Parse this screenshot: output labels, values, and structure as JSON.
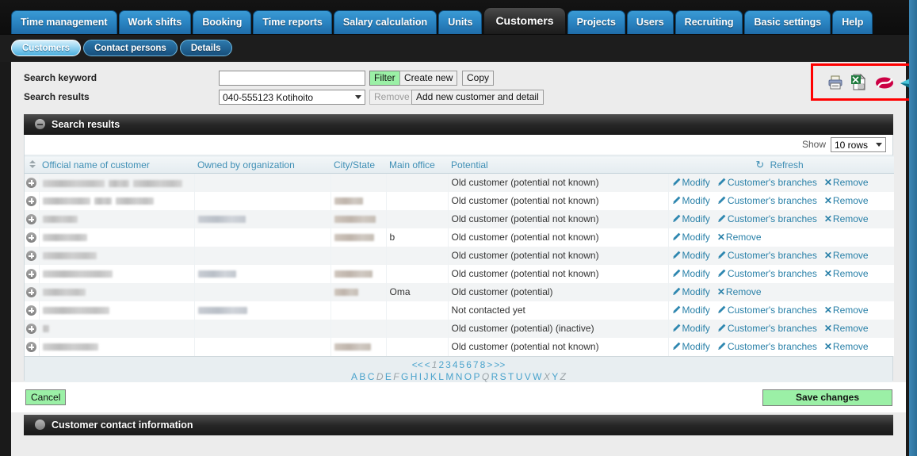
{
  "app": {
    "main_tabs": [
      {
        "label": "Time management",
        "active": false
      },
      {
        "label": "Work shifts",
        "active": false
      },
      {
        "label": "Booking",
        "active": false
      },
      {
        "label": "Time reports",
        "active": false
      },
      {
        "label": "Salary calculation",
        "active": false
      },
      {
        "label": "Units",
        "active": false
      },
      {
        "label": "Customers",
        "active": true
      },
      {
        "label": "Projects",
        "active": false
      },
      {
        "label": "Users",
        "active": false
      },
      {
        "label": "Recruiting",
        "active": false
      },
      {
        "label": "Basic settings",
        "active": false
      },
      {
        "label": "Help",
        "active": false
      }
    ],
    "sub_tabs": [
      {
        "label": "Customers",
        "selected": true
      },
      {
        "label": "Contact persons",
        "selected": false
      },
      {
        "label": "Details",
        "selected": false
      }
    ]
  },
  "search": {
    "keyword_label": "Search keyword",
    "keyword_value": "",
    "keyword_placeholder": "",
    "filter_button": "Filter",
    "create_new_button": "Create new",
    "copy_button": "Copy",
    "results_label": "Search results",
    "results_selected": "040-555123 Kotihoito",
    "remove_button": "Remove",
    "add_new_button": "Add new customer and detail"
  },
  "toolbar_icons": [
    {
      "name": "print-icon",
      "title": "Print"
    },
    {
      "name": "excel-export-icon",
      "title": "Export to Excel"
    },
    {
      "name": "red-oval-icon",
      "title": "PDF"
    },
    {
      "name": "teal-arrow-icon",
      "title": "Send"
    }
  ],
  "sections": {
    "search_results_title": "Search results",
    "contact_info_title": "Customer contact information"
  },
  "table": {
    "show_label": "Show",
    "show_value": "10 rows",
    "refresh_label": "Refresh",
    "columns": [
      "Official name of customer",
      "Owned by organization",
      "City/State",
      "Main office",
      "Potential"
    ],
    "actions": {
      "modify": "Modify",
      "branches": "Customer's branches",
      "remove": "Remove"
    },
    "rows": [
      {
        "name_w": [
          78,
          26,
          62
        ],
        "org_w": [],
        "city_w": [],
        "office": "",
        "potential": "Old customer (potential not known)",
        "has_branches": true
      },
      {
        "name_w": [
          60,
          22,
          48
        ],
        "org_w": [],
        "city_w": [
          36
        ],
        "office": "",
        "potential": "Old customer (potential not known)",
        "has_branches": true
      },
      {
        "name_w": [
          44
        ],
        "org_w": [
          60
        ],
        "city_w": [
          52
        ],
        "office": "",
        "potential": "Old customer (potential not known)",
        "has_branches": true
      },
      {
        "name_w": [
          56
        ],
        "org_w": [],
        "city_w": [
          50
        ],
        "office": "b",
        "potential": "Old customer (potential not known)",
        "has_branches": false
      },
      {
        "name_w": [
          68
        ],
        "org_w": [],
        "city_w": [],
        "office": "",
        "potential": "Old customer (potential not known)",
        "has_branches": true
      },
      {
        "name_w": [
          88
        ],
        "org_w": [
          48
        ],
        "city_w": [
          48
        ],
        "office": "",
        "potential": "Old customer (potential not known)",
        "has_branches": true
      },
      {
        "name_w": [
          54
        ],
        "org_w": [],
        "city_w": [
          30
        ],
        "office": "Oma",
        "potential": "Old customer (potential)",
        "has_branches": false
      },
      {
        "name_w": [
          84
        ],
        "org_w": [
          62
        ],
        "city_w": [],
        "office": "",
        "potential": "Not contacted yet",
        "has_branches": true
      },
      {
        "name_w": [
          8
        ],
        "org_w": [],
        "city_w": [],
        "office": "",
        "potential": "Old customer (potential) (inactive)",
        "has_branches": true
      },
      {
        "name_w": [
          70
        ],
        "org_w": [],
        "city_w": [
          46
        ],
        "office": "",
        "potential": "Old customer (potential not known)",
        "has_branches": true
      }
    ]
  },
  "pager": {
    "first": "<<",
    "prev": "<",
    "pages": [
      {
        "label": "1",
        "current": true
      },
      {
        "label": "2",
        "current": false
      },
      {
        "label": "3",
        "current": false
      },
      {
        "label": "4",
        "current": false
      },
      {
        "label": "5",
        "current": false
      },
      {
        "label": "6",
        "current": false
      },
      {
        "label": "7",
        "current": false
      },
      {
        "label": "8",
        "current": false
      }
    ],
    "next": ">",
    "last": ">>",
    "letters": [
      {
        "label": "A",
        "enabled": true
      },
      {
        "label": "B",
        "enabled": true
      },
      {
        "label": "C",
        "enabled": true
      },
      {
        "label": "D",
        "enabled": false
      },
      {
        "label": "E",
        "enabled": true
      },
      {
        "label": "F",
        "enabled": false
      },
      {
        "label": "G",
        "enabled": true
      },
      {
        "label": "H",
        "enabled": true
      },
      {
        "label": "I",
        "enabled": true
      },
      {
        "label": "J",
        "enabled": true
      },
      {
        "label": "K",
        "enabled": true
      },
      {
        "label": "L",
        "enabled": true
      },
      {
        "label": "M",
        "enabled": true
      },
      {
        "label": "N",
        "enabled": true
      },
      {
        "label": "O",
        "enabled": true
      },
      {
        "label": "P",
        "enabled": true
      },
      {
        "label": "Q",
        "enabled": false
      },
      {
        "label": "R",
        "enabled": true
      },
      {
        "label": "S",
        "enabled": true
      },
      {
        "label": "T",
        "enabled": true
      },
      {
        "label": "U",
        "enabled": true
      },
      {
        "label": "V",
        "enabled": true
      },
      {
        "label": "W",
        "enabled": true
      },
      {
        "label": "X",
        "enabled": false
      },
      {
        "label": "Y",
        "enabled": true
      },
      {
        "label": "Z",
        "enabled": false
      }
    ]
  },
  "footer": {
    "cancel_button": "Cancel",
    "save_button": "Save changes"
  },
  "colors": {
    "accent_blue": "#2b86c4",
    "link_blue": "#2980a8",
    "green_button": "#9bf0a6",
    "highlight_red": "#ff0000",
    "dark_header": "#262626"
  }
}
